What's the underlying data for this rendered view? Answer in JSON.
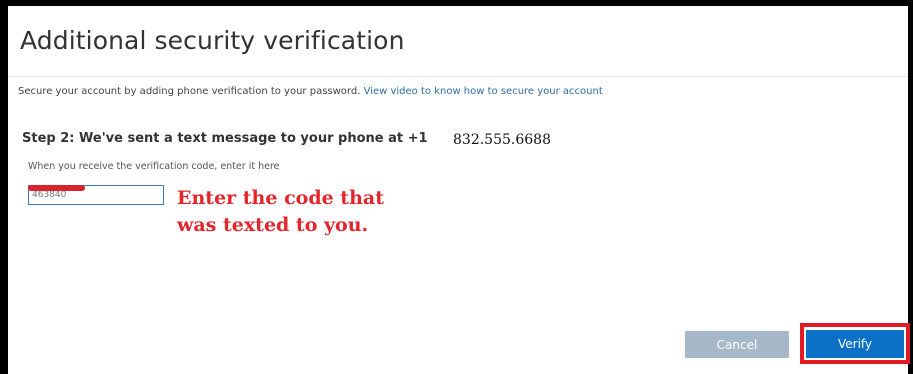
{
  "page": {
    "title": "Additional security verification"
  },
  "intro": {
    "text": "Secure your account by adding phone verification to your password.",
    "link_text": "View video to know how to secure your account"
  },
  "step": {
    "heading": "Step 2: We've sent a text message to your phone at +1",
    "phone_number": "832.555.6688",
    "instruction": "When you receive the verification code, enter it here"
  },
  "code_input": {
    "value": "463840"
  },
  "annotation": {
    "line1": "Enter the code that",
    "line2": "was texted to you."
  },
  "buttons": {
    "cancel_label": "Cancel",
    "verify_label": "Verify"
  },
  "colors": {
    "primary_button": "#0d70c7",
    "disabled_button": "#a7b9c9",
    "highlight_red": "#e11a24",
    "link": "#2f6ea5"
  }
}
